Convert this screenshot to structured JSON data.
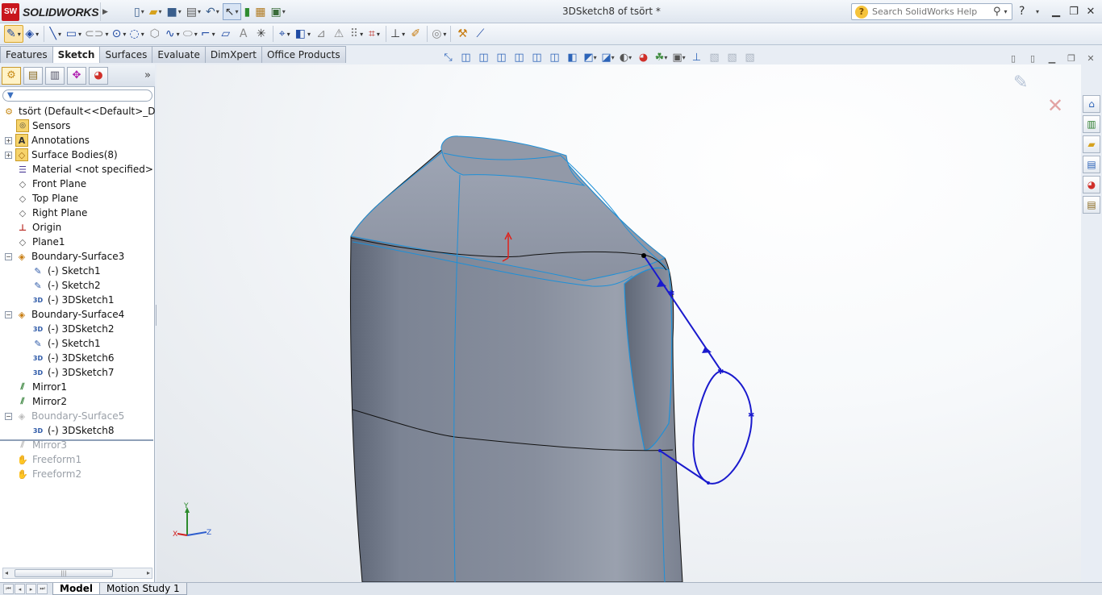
{
  "app": {
    "logo_text": "SOLIDWORKS",
    "document_title": "3DSketch8 of tsört *",
    "search_placeholder": "Search SolidWorks Help"
  },
  "quick_access": [
    "new-icon",
    "open-icon",
    "save-icon",
    "print-icon",
    "undo-icon",
    "select-icon",
    "rebuild-icon",
    "options-icon"
  ],
  "command_tabs": [
    {
      "label": "Features",
      "active": false
    },
    {
      "label": "Sketch",
      "active": true
    },
    {
      "label": "Surfaces",
      "active": false
    },
    {
      "label": "Evaluate",
      "active": false
    },
    {
      "label": "DimXpert",
      "active": false
    },
    {
      "label": "Office Products",
      "active": false
    }
  ],
  "feature_tree": {
    "filter_placeholder": "",
    "items": [
      {
        "label": "tsört  (Default<<Default>_Displa",
        "icon": "part-icon",
        "indent": 0,
        "expander": "",
        "dim": false
      },
      {
        "label": "Sensors",
        "icon": "sensors-icon",
        "indent": 1,
        "expander": "",
        "dim": false
      },
      {
        "label": "Annotations",
        "icon": "annotations-icon",
        "indent": 1,
        "expander": "+",
        "dim": false
      },
      {
        "label": "Surface Bodies(8)",
        "icon": "surface-bodies-icon",
        "indent": 1,
        "expander": "+",
        "dim": false
      },
      {
        "label": "Material <not specified>",
        "icon": "material-icon",
        "indent": 1,
        "expander": "",
        "dim": false
      },
      {
        "label": "Front Plane",
        "icon": "plane-icon",
        "indent": 1,
        "expander": "",
        "dim": false
      },
      {
        "label": "Top Plane",
        "icon": "plane-icon",
        "indent": 1,
        "expander": "",
        "dim": false
      },
      {
        "label": "Right Plane",
        "icon": "plane-icon",
        "indent": 1,
        "expander": "",
        "dim": false
      },
      {
        "label": "Origin",
        "icon": "origin-icon",
        "indent": 1,
        "expander": "",
        "dim": false
      },
      {
        "label": "Plane1",
        "icon": "plane-icon",
        "indent": 1,
        "expander": "",
        "dim": false
      },
      {
        "label": "Boundary-Surface3",
        "icon": "boundary-surface-icon",
        "indent": 1,
        "expander": "-",
        "dim": false
      },
      {
        "label": "(-) Sketch1",
        "icon": "sketch-icon",
        "indent": 2,
        "expander": "",
        "dim": false
      },
      {
        "label": "(-) Sketch2",
        "icon": "sketch-icon",
        "indent": 2,
        "expander": "",
        "dim": false
      },
      {
        "label": "(-) 3DSketch1",
        "icon": "3dsketch-icon",
        "indent": 2,
        "expander": "",
        "dim": false
      },
      {
        "label": "Boundary-Surface4",
        "icon": "boundary-surface-icon",
        "indent": 1,
        "expander": "-",
        "dim": false
      },
      {
        "label": "(-) 3DSketch2",
        "icon": "3dsketch-icon",
        "indent": 2,
        "expander": "",
        "dim": false
      },
      {
        "label": "(-) Sketch1",
        "icon": "sketch-icon",
        "indent": 2,
        "expander": "",
        "dim": false
      },
      {
        "label": "(-) 3DSketch6",
        "icon": "3dsketch-icon",
        "indent": 2,
        "expander": "",
        "dim": false
      },
      {
        "label": "(-) 3DSketch7",
        "icon": "3dsketch-icon",
        "indent": 2,
        "expander": "",
        "dim": false
      },
      {
        "label": "Mirror1",
        "icon": "mirror-icon",
        "indent": 1,
        "expander": "",
        "dim": false
      },
      {
        "label": "Mirror2",
        "icon": "mirror-icon",
        "indent": 1,
        "expander": "",
        "dim": false
      },
      {
        "label": "Boundary-Surface5",
        "icon": "boundary-surface-icon",
        "indent": 1,
        "expander": "-",
        "dim": true
      },
      {
        "label": "(-) 3DSketch8",
        "icon": "3dsketch-icon",
        "indent": 2,
        "expander": "",
        "dim": false
      },
      {
        "label": "Mirror3",
        "icon": "mirror-icon",
        "indent": 1,
        "expander": "",
        "dim": true
      },
      {
        "label": "Freeform1",
        "icon": "freeform-icon",
        "indent": 1,
        "expander": "",
        "dim": true
      },
      {
        "label": "Freeform2",
        "icon": "freeform-icon",
        "indent": 1,
        "expander": "",
        "dim": true
      }
    ]
  },
  "triad": {
    "x": "X",
    "y": "Y",
    "z": "Z"
  },
  "bottom_tabs": [
    {
      "label": "Model",
      "active": true
    },
    {
      "label": "Motion Study 1",
      "active": false
    }
  ],
  "colors": {
    "sketch_blue": "#1a1acd",
    "edge_cyan": "#1e90d8",
    "body_gray": "#7f8797",
    "accent_red": "#e0201a"
  }
}
